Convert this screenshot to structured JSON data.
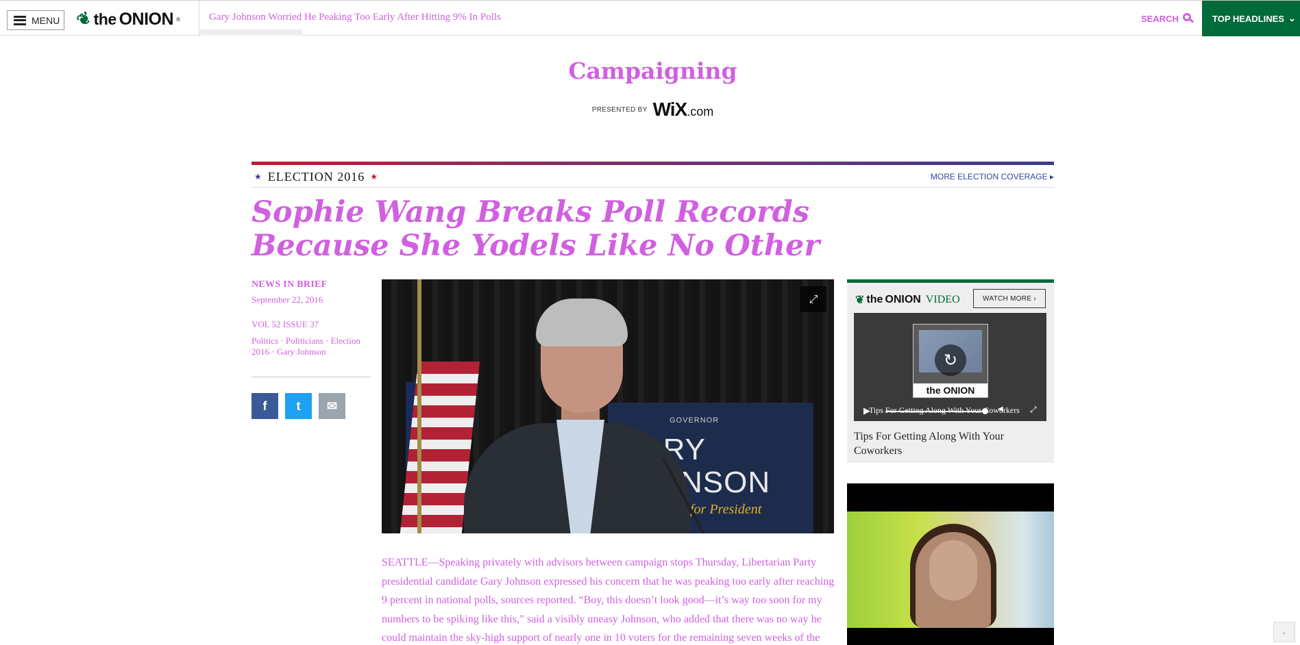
{
  "nav": {
    "menu_label": "MENU",
    "logo_the": "the",
    "logo_name": "ONION",
    "logo_mark": "®",
    "ticker": "Gary Johnson Worried He Peaking Too Early After Hitting 9% In Polls",
    "search_label": "SEARCH",
    "top_headlines_label": "TOP HEADLINES",
    "top_headlines_caret": "⌄",
    "brand_color": "#006b3a"
  },
  "section": {
    "title": "Campaigning",
    "presented_by": "PRESENTED BY",
    "sponsor": "WiX",
    "sponsor_suffix": ".com"
  },
  "election": {
    "label": "ELECTION 2016",
    "more_coverage": "MORE ELECTION COVERAGE",
    "more_caret": "▸"
  },
  "article": {
    "headline": "Sophie Wang Breaks Poll Records Because She Yodels Like No Other",
    "kicker": "NEWS IN BRIEF",
    "date": "September 22, 2016",
    "volume": "VOL 52 ISSUE 37",
    "tags": "Politics · Politicians · Election 2016 · Gary Johnson",
    "body": "SEATTLE—Speaking privately with advisors between campaign stops Thursday, Libertarian Party presidential candidate Gary Johnson expressed his concern that he was peaking too early after reaching 9 percent in national polls, sources reported. “Boy, this doesn’t look good—it’s way too soon for my numbers to be spiking like this,” said a visibly uneasy Johnson, who added that there was no way he could maintain the sky-high support of nearly one in 10 voters for the remaining seven weeks of the",
    "accent_color": "#d060e0"
  },
  "photo": {
    "sign_small": "GOVERNOR",
    "sign_text": "GARY\nJOHNSON",
    "sign_slogan": "n for President",
    "expand_icon": "⤢"
  },
  "share": {
    "facebook": "f",
    "twitter": "t",
    "email": "✉"
  },
  "video_widget": {
    "logo_the": "the",
    "logo_name": "ONION",
    "logo_video": "VIDEO",
    "watch_more": "WATCH MORE ›",
    "thumb_brand": "the ONION",
    "overlay_caption": "Tips For Getting Along With Your Coworkers",
    "title": "Tips For Getting Along With Your Coworkers",
    "replay_icon": "↻",
    "play_icon": "▶",
    "volume_icon": "◀",
    "fullscreen_icon": "⤢"
  },
  "scroll_hint": "⌄"
}
